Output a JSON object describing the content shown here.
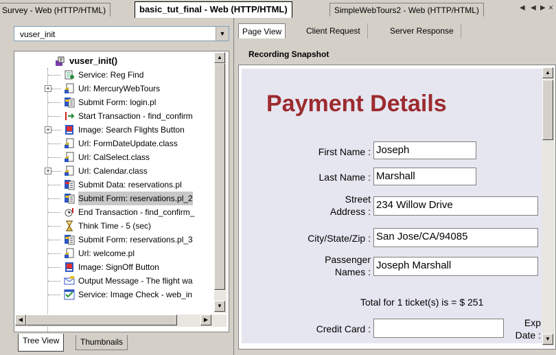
{
  "doc_tabs": [
    {
      "label": "Survey - Web (HTTP/HTML)",
      "active": false
    },
    {
      "label": "basic_tut_final - Web (HTTP/HTML)",
      "active": true
    },
    {
      "label": "SimpleWebTours2 - Web (HTTP/HTML)",
      "active": false
    }
  ],
  "left": {
    "dropdown_value": "vuser_init",
    "tree": {
      "root": "vuser_init()",
      "items": [
        {
          "label": "Service: Reg Find",
          "icon": "service-icon"
        },
        {
          "label": "Url: MercuryWebTours",
          "icon": "url-icon",
          "expandable": true
        },
        {
          "label": "Submit Form: login.pl",
          "icon": "submit-form-icon"
        },
        {
          "label": "Start Transaction - find_confirm",
          "icon": "start-transaction-icon"
        },
        {
          "label": "Image: Search Flights Button",
          "icon": "image-icon",
          "expandable": true
        },
        {
          "label": "Url: FormDateUpdate.class",
          "icon": "url-icon"
        },
        {
          "label": "Url: CalSelect.class",
          "icon": "url-icon"
        },
        {
          "label": "Url: Calendar.class",
          "icon": "url-icon",
          "expandable": true
        },
        {
          "label": "Submit Data: reservations.pl",
          "icon": "submit-data-icon"
        },
        {
          "label": "Submit Form: reservations.pl_2",
          "icon": "submit-form-icon",
          "selected": true
        },
        {
          "label": "End Transaction - find_confirm_",
          "icon": "end-transaction-icon"
        },
        {
          "label": "Think Time - 5 (sec)",
          "icon": "hourglass-icon"
        },
        {
          "label": "Submit Form: reservations.pl_3",
          "icon": "submit-form-icon"
        },
        {
          "label": "Url: welcome.pl",
          "icon": "url-icon"
        },
        {
          "label": "Image: SignOff Button",
          "icon": "image-icon"
        },
        {
          "label": "Output Message - The flight wa",
          "icon": "output-message-icon"
        },
        {
          "label": "Service: Image Check - web_in",
          "icon": "image-check-icon"
        }
      ]
    },
    "bottom_tabs": [
      {
        "label": "Tree View",
        "active": true
      },
      {
        "label": "Thumbnails",
        "active": false
      }
    ]
  },
  "right": {
    "view_tabs": [
      {
        "label": "Page View",
        "active": true
      },
      {
        "label": "Client Request",
        "active": false
      },
      {
        "label": "Server Response",
        "active": false
      }
    ],
    "snapshot_label": "Recording Snapshot",
    "page": {
      "title": "Payment Details",
      "fields": [
        {
          "label": "First Name :",
          "value": "Joseph"
        },
        {
          "label": "Last Name :",
          "value": "Marshall"
        },
        {
          "label_line1": "Street",
          "label_line2": "Address :",
          "value": "234 Willow Drive"
        },
        {
          "label": "City/State/Zip :",
          "value": "San Jose/CA/94085"
        },
        {
          "label_line1": "Passenger",
          "label_line2": "Names :",
          "value": "Joseph Marshall"
        }
      ],
      "total": "Total for 1 ticket(s) is = $ 251",
      "credit_card_label": "Credit Card :",
      "credit_card_value": "",
      "exp_line1": "Exp",
      "exp_line2": "Date :"
    }
  },
  "colors": {
    "title_red": "#9c2b2e",
    "snapshot_bg": "#e6e6f0",
    "chrome": "#d4d0c8"
  }
}
